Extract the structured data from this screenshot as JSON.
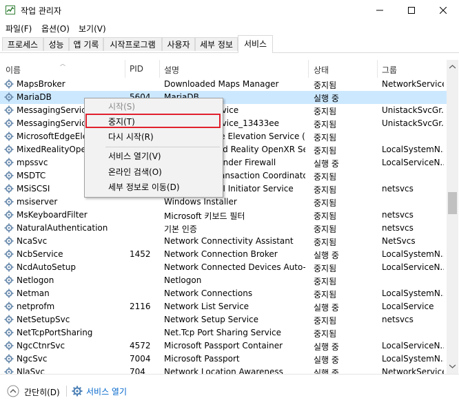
{
  "window": {
    "title": "작업 관리자"
  },
  "menu": [
    "파일(F)",
    "옵션(O)",
    "보기(V)"
  ],
  "tabs": [
    "프로세스",
    "성능",
    "앱 기록",
    "시작프로그램",
    "사용자",
    "세부 정보",
    "서비스"
  ],
  "columns": {
    "name": "이름",
    "pid": "PID",
    "desc": "설명",
    "status": "상태",
    "group": "그룹"
  },
  "rows": [
    {
      "name": "MapsBroker",
      "pid": "",
      "desc": "Downloaded Maps Manager",
      "status": "중지됨",
      "group": "NetworkService"
    },
    {
      "name": "MariaDB",
      "pid": "5604",
      "desc": "MariaDB",
      "status": "실행 중",
      "group": ""
    },
    {
      "name": "MessagingService",
      "pid": "",
      "desc": "MessagingService",
      "status": "중지됨",
      "group": "UnistackSvcGr..."
    },
    {
      "name": "MessagingService_13433ee",
      "pid": "",
      "desc": "MessagingService_13433ee",
      "status": "중지됨",
      "group": "UnistackSvcGr..."
    },
    {
      "name": "MicrosoftEdgeElevationService",
      "pid": "",
      "desc": "Microsoft Edge Elevation Service (",
      "status": "중지됨",
      "group": ""
    },
    {
      "name": "MixedRealityOpenXRSvc",
      "pid": "",
      "desc": "Windows Mixed Reality OpenXR Ser...",
      "status": "중지됨",
      "group": "LocalSystemN..."
    },
    {
      "name": "mpssvc",
      "pid": "",
      "desc": "Windows Defender Firewall",
      "status": "실행 중",
      "group": "LocalServiceN..."
    },
    {
      "name": "MSDTC",
      "pid": "",
      "desc": "Distributed Transaction Coordinator",
      "status": "중지됨",
      "group": ""
    },
    {
      "name": "MSiSCSI",
      "pid": "",
      "desc": "Microsoft iSCSI Initiator Service",
      "status": "중지됨",
      "group": "netsvcs"
    },
    {
      "name": "msiserver",
      "pid": "",
      "desc": "Windows Installer",
      "status": "중지됨",
      "group": ""
    },
    {
      "name": "MsKeyboardFilter",
      "pid": "",
      "desc": "Microsoft 키보드 필터",
      "status": "중지됨",
      "group": "netsvcs"
    },
    {
      "name": "NaturalAuthentication",
      "pid": "",
      "desc": "기본 인증",
      "status": "중지됨",
      "group": "netsvcs"
    },
    {
      "name": "NcaSvc",
      "pid": "",
      "desc": "Network Connectivity Assistant",
      "status": "중지됨",
      "group": "NetSvcs"
    },
    {
      "name": "NcbService",
      "pid": "1452",
      "desc": "Network Connection Broker",
      "status": "실행 중",
      "group": "LocalSystemN..."
    },
    {
      "name": "NcdAutoSetup",
      "pid": "",
      "desc": "Network Connected Devices Auto-...",
      "status": "중지됨",
      "group": "LocalServiceN..."
    },
    {
      "name": "Netlogon",
      "pid": "",
      "desc": "Netlogon",
      "status": "중지됨",
      "group": ""
    },
    {
      "name": "Netman",
      "pid": "",
      "desc": "Network Connections",
      "status": "중지됨",
      "group": "LocalSystemN..."
    },
    {
      "name": "netprofm",
      "pid": "2116",
      "desc": "Network List Service",
      "status": "실행 중",
      "group": "LocalService"
    },
    {
      "name": "NetSetupSvc",
      "pid": "",
      "desc": "Network Setup Service",
      "status": "중지됨",
      "group": "netsvcs"
    },
    {
      "name": "NetTcpPortSharing",
      "pid": "",
      "desc": "Net.Tcp Port Sharing Service",
      "status": "중지됨",
      "group": ""
    },
    {
      "name": "NgcCtnrSvc",
      "pid": "4572",
      "desc": "Microsoft Passport Container",
      "status": "실행 중",
      "group": "LocalServiceN..."
    },
    {
      "name": "NgcSvc",
      "pid": "7004",
      "desc": "Microsoft Passport",
      "status": "실행 중",
      "group": "LocalSystemN..."
    },
    {
      "name": "NlaSvc",
      "pid": "704",
      "desc": "Network Location Awareness",
      "status": "실행 중",
      "group": "NetworkService"
    }
  ],
  "context_menu": {
    "start": "시작(S)",
    "stop": "중지(T)",
    "restart": "다시 시작(R)",
    "open_services": "서비스 열기(V)",
    "search_online": "온라인 검색(O)",
    "go_to_details": "세부 정보로 이동(D)"
  },
  "footer": {
    "fewer_details": "간단히(D)",
    "open_services": "서비스 열기"
  },
  "colors": {
    "selection": "#cce8ff",
    "highlight_border": "#e0202c",
    "link": "#0066cc"
  }
}
